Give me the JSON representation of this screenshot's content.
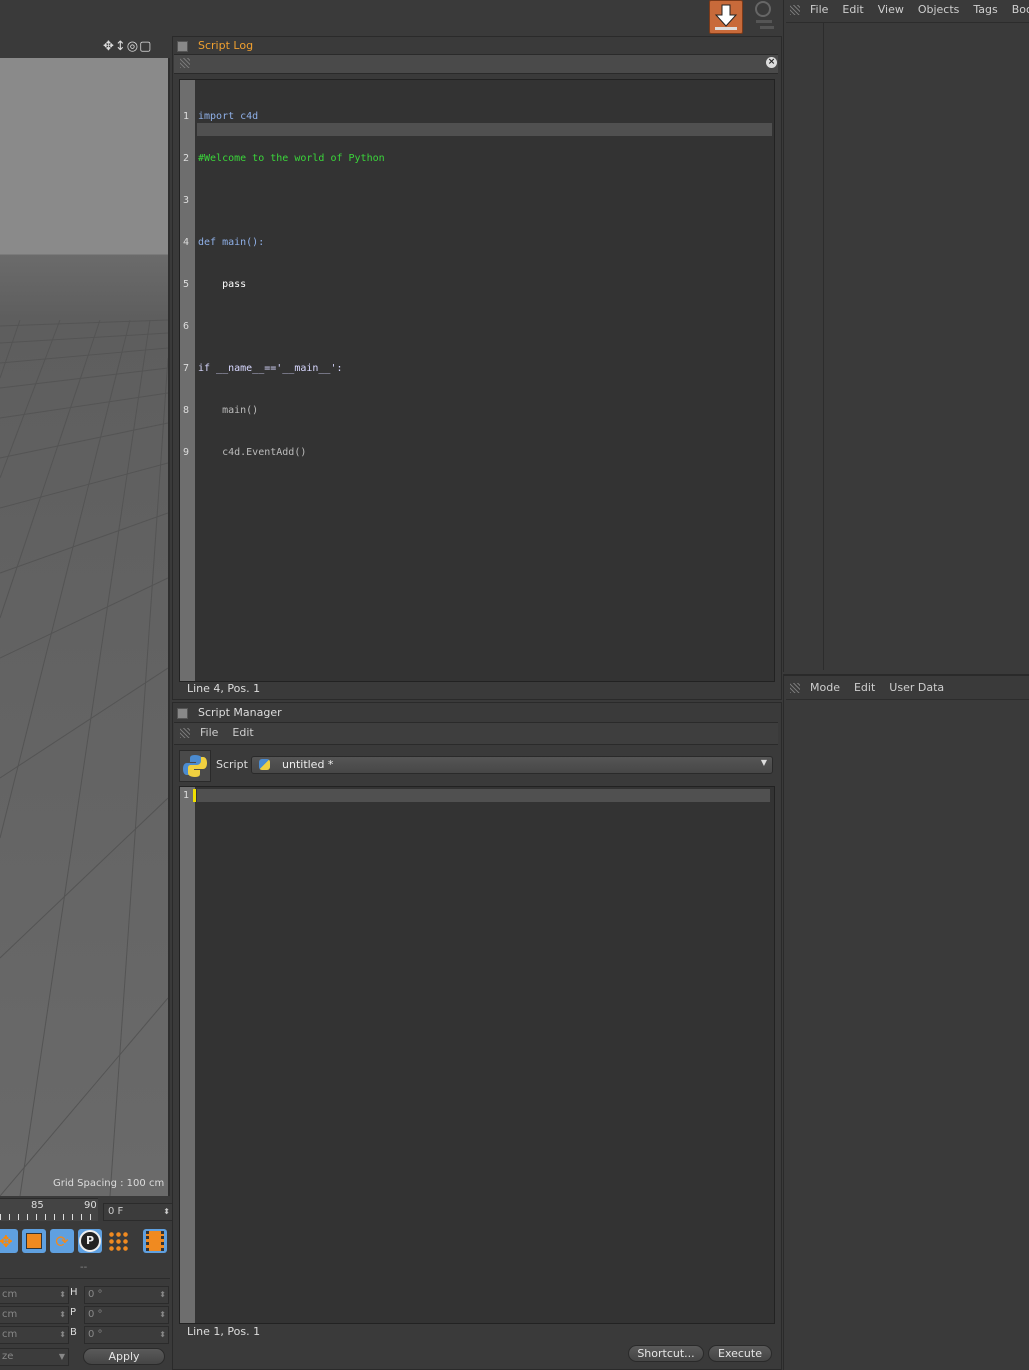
{
  "top_menu": {
    "items": [
      "File",
      "Edit",
      "View",
      "Objects",
      "Tags",
      "Bookm"
    ]
  },
  "viewport": {
    "grid_spacing": "Grid Spacing : 100 cm"
  },
  "timeline": {
    "tick_85": "85",
    "tick_90": "90",
    "frame_field": "0 F"
  },
  "coords": {
    "rows": [
      {
        "left": "cm",
        "axis": "H",
        "value": "0 °"
      },
      {
        "left": "cm",
        "axis": "P",
        "value": "0 °"
      },
      {
        "left": "cm",
        "axis": "B",
        "value": "0 °"
      }
    ],
    "separator": "--",
    "size_dropdown": "ze",
    "apply_label": "Apply"
  },
  "script_log": {
    "title": "Script Log",
    "status": "Line 4, Pos. 1",
    "code": [
      {
        "n": "1",
        "text": "import c4d"
      },
      {
        "n": "2",
        "text": "#Welcome to the world of Python"
      },
      {
        "n": "3",
        "text": ""
      },
      {
        "n": "4",
        "text": "def main():"
      },
      {
        "n": "5",
        "text": "    pass"
      },
      {
        "n": "6",
        "text": ""
      },
      {
        "n": "7",
        "text": "if __name__=='__main__':"
      },
      {
        "n": "8",
        "text": "    main()"
      },
      {
        "n": "9",
        "text": "    c4d.EventAdd()"
      }
    ]
  },
  "script_manager": {
    "title": "Script Manager",
    "menu": [
      "File",
      "Edit"
    ],
    "script_label": "Script",
    "script_value": "untitled *",
    "line_number": "1",
    "status": "Line 1, Pos. 1",
    "shortcut_label": "Shortcut...",
    "execute_label": "Execute"
  },
  "attributes": {
    "menu": [
      "Mode",
      "Edit",
      "User Data"
    ]
  },
  "colors": {
    "panel_bg": "#3a3a3a",
    "editor_bg": "#333333",
    "title_orange": "#f0a030",
    "comment_green": "#3ad63a",
    "keyword_blue": "#8fb0e8",
    "string_purple": "#9a7ae0",
    "cursor_yellow": "#f0e000"
  }
}
